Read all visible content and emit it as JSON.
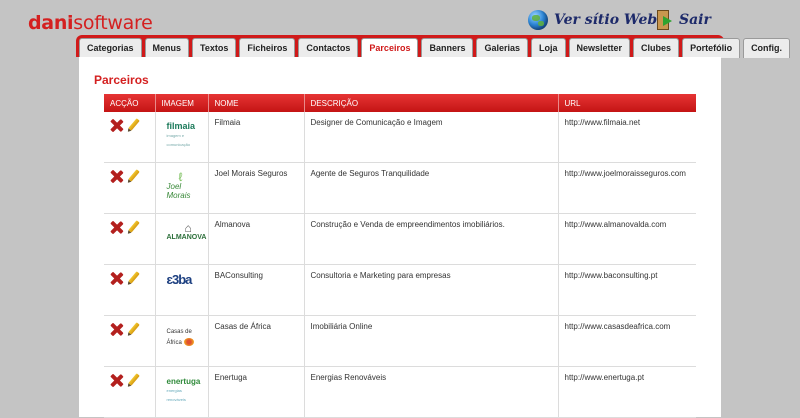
{
  "logo": {
    "part1": "dani",
    "part2": "software"
  },
  "header": {
    "web_link": "Ver sítio Web",
    "logout": "Sair"
  },
  "tabs": [
    {
      "label": "Categorias"
    },
    {
      "label": "Menus"
    },
    {
      "label": "Textos"
    },
    {
      "label": "Ficheiros"
    },
    {
      "label": "Contactos"
    },
    {
      "label": "Parceiros",
      "active": true
    },
    {
      "label": "Banners"
    },
    {
      "label": "Galerias"
    },
    {
      "label": "Loja"
    },
    {
      "label": "Newsletter"
    },
    {
      "label": "Clubes"
    },
    {
      "label": "Portefólio"
    },
    {
      "label": "Config."
    }
  ],
  "page": {
    "title": "Parceiros"
  },
  "table": {
    "headers": [
      "ACÇÃO",
      "IMAGEM",
      "NOME",
      "DESCRIÇÃO",
      "URL"
    ],
    "rows": [
      {
        "nome": "Filmaia",
        "descricao": "Designer de Comunicação e Imagem",
        "url": "http://www.filmaia.net",
        "thumb": {
          "name": "filmaia",
          "sub": "imagem e comunicação"
        }
      },
      {
        "nome": "Joel Morais Seguros",
        "descricao": "Agente de Seguros Tranquilidade",
        "url": "http://www.joelmoraisseguros.com",
        "thumb": {
          "mark": "ℓ",
          "name": "Joel Morais"
        }
      },
      {
        "nome": "Almanova",
        "descricao": "Construção e Venda de empreendimentos imobiliários.",
        "url": "http://www.almanovalda.com",
        "thumb": {
          "mark": "⌂",
          "name": "ALMANOVA"
        }
      },
      {
        "nome": "BAConsulting",
        "descricao": "Consultoria e Marketing para empresas",
        "url": "http://www.baconsulting.pt",
        "thumb": {
          "name": "ɛ3ba"
        }
      },
      {
        "nome": "Casas de África",
        "descricao": "Imobiliária Online",
        "url": "http://www.casasdeafrica.com",
        "thumb": {
          "name": "Casas de África"
        }
      },
      {
        "nome": "Enertuga",
        "descricao": "Energias Renováveis",
        "url": "http://www.enertuga.pt",
        "thumb": {
          "name": "enertuga",
          "sub": "energias renováveis"
        }
      }
    ]
  }
}
